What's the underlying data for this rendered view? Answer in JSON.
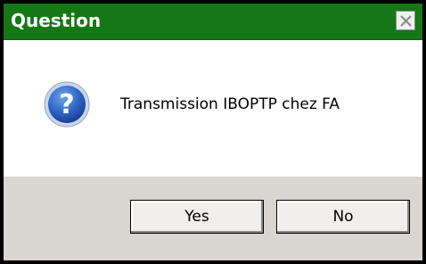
{
  "window": {
    "title": "Question",
    "title_bar_color": "#157715"
  },
  "message": {
    "icon": "question-icon",
    "text": "Transmission IBOPTP chez FA"
  },
  "buttons": {
    "yes_label": "Yes",
    "no_label": "No"
  },
  "icons": {
    "close": "close-icon"
  }
}
